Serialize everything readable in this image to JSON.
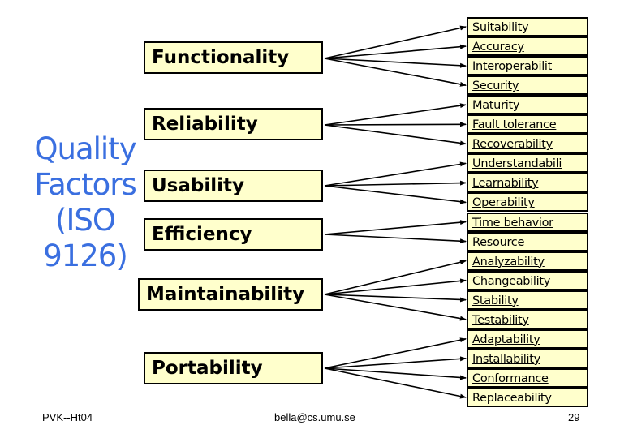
{
  "title_lines": [
    "Quality",
    "Factors",
    "(ISO",
    "9126)"
  ],
  "title_color": "#3a6fe0",
  "factor_fill": "#ffffcc",
  "factors": [
    {
      "label": "Functionality",
      "subs": [
        0,
        1,
        2,
        3
      ]
    },
    {
      "label": "Reliability",
      "subs": [
        4,
        5,
        6
      ]
    },
    {
      "label": "Usability",
      "subs": [
        7,
        8,
        9
      ]
    },
    {
      "label": "Efficiency",
      "subs": [
        10,
        11
      ]
    },
    {
      "label": "Maintainability",
      "subs": [
        12,
        13,
        14,
        15
      ]
    },
    {
      "label": "Portability",
      "subs": [
        16,
        17,
        18,
        19
      ]
    }
  ],
  "subfactors": [
    {
      "label": "Suitability",
      "underlined": true
    },
    {
      "label": "Accuracy",
      "underlined": true
    },
    {
      "label": "Interoperabilit",
      "underlined": true
    },
    {
      "label": "Security",
      "underlined": true
    },
    {
      "label": "Maturity",
      "underlined": true
    },
    {
      "label": "Fault tolerance",
      "underlined": true
    },
    {
      "label": "Recoverability",
      "underlined": true
    },
    {
      "label": "Understandabili",
      "underlined": true
    },
    {
      "label": "Learnability",
      "underlined": true
    },
    {
      "label": "Operability",
      "underlined": true
    },
    {
      "label": "Time behavior",
      "underlined": true
    },
    {
      "label": "Resource",
      "underlined": true
    },
    {
      "label": "Analyzability",
      "underlined": true
    },
    {
      "label": "Changeability",
      "underlined": true
    },
    {
      "label": "Stability",
      "underlined": true
    },
    {
      "label": "Testability",
      "underlined": true
    },
    {
      "label": "Adaptability",
      "underlined": true
    },
    {
      "label": "Installability",
      "underlined": true
    },
    {
      "label": "Conformance",
      "underlined": true
    },
    {
      "label": "Replaceability",
      "underlined": false
    }
  ],
  "footer": {
    "left": "PVK--Ht04",
    "center": "bella@cs.umu.se",
    "page_number": "29"
  }
}
